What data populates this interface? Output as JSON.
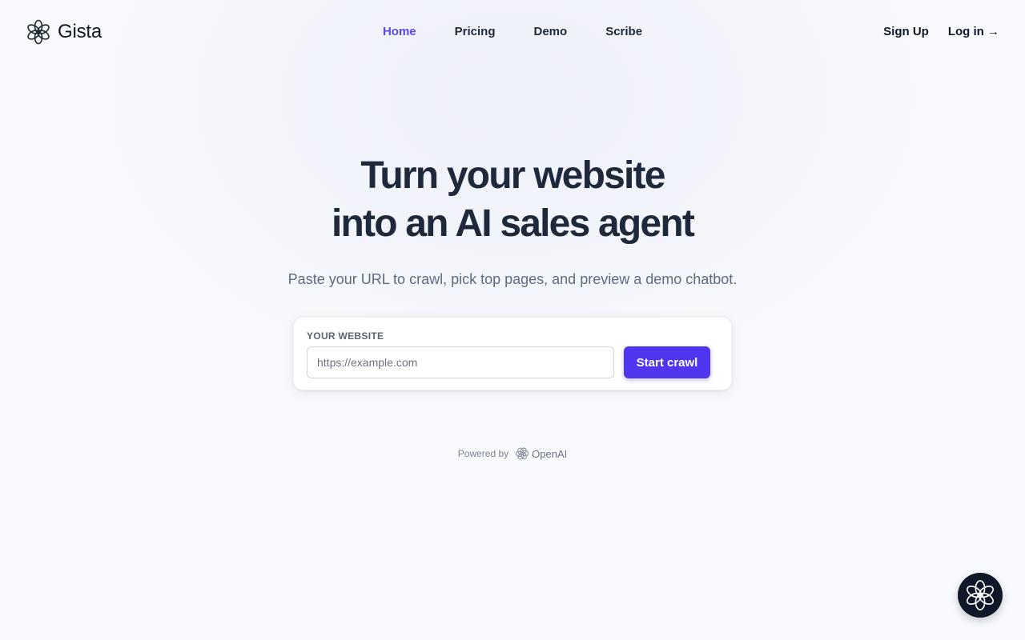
{
  "brand": {
    "name": "Gista",
    "logo_icon": "flower-logo-icon"
  },
  "nav": {
    "items": [
      {
        "label": "Home",
        "active": true
      },
      {
        "label": "Pricing",
        "active": false
      },
      {
        "label": "Demo",
        "active": false
      },
      {
        "label": "Scribe",
        "active": false
      }
    ]
  },
  "auth": {
    "signup_label": "Sign Up",
    "login_label": "Log in →"
  },
  "hero": {
    "title_line1": "Turn your website",
    "title_line2": "into an AI sales agent",
    "subtitle": "Paste your URL to crawl, pick top pages, and preview a demo chatbot."
  },
  "form": {
    "label": "YOUR WEBSITE",
    "url_value": "",
    "url_placeholder": "https://example.com",
    "submit_label": "Start crawl"
  },
  "footer": {
    "powered_by": "Powered by",
    "partner": "OpenAI",
    "partner_icon": "openai-icon"
  },
  "chat_widget": {
    "icon": "flower-logo-icon"
  },
  "colors": {
    "accent": "#4f35f0",
    "nav_active": "#5b46e8",
    "heading": "#1e293b",
    "chat_bg": "#101828"
  }
}
